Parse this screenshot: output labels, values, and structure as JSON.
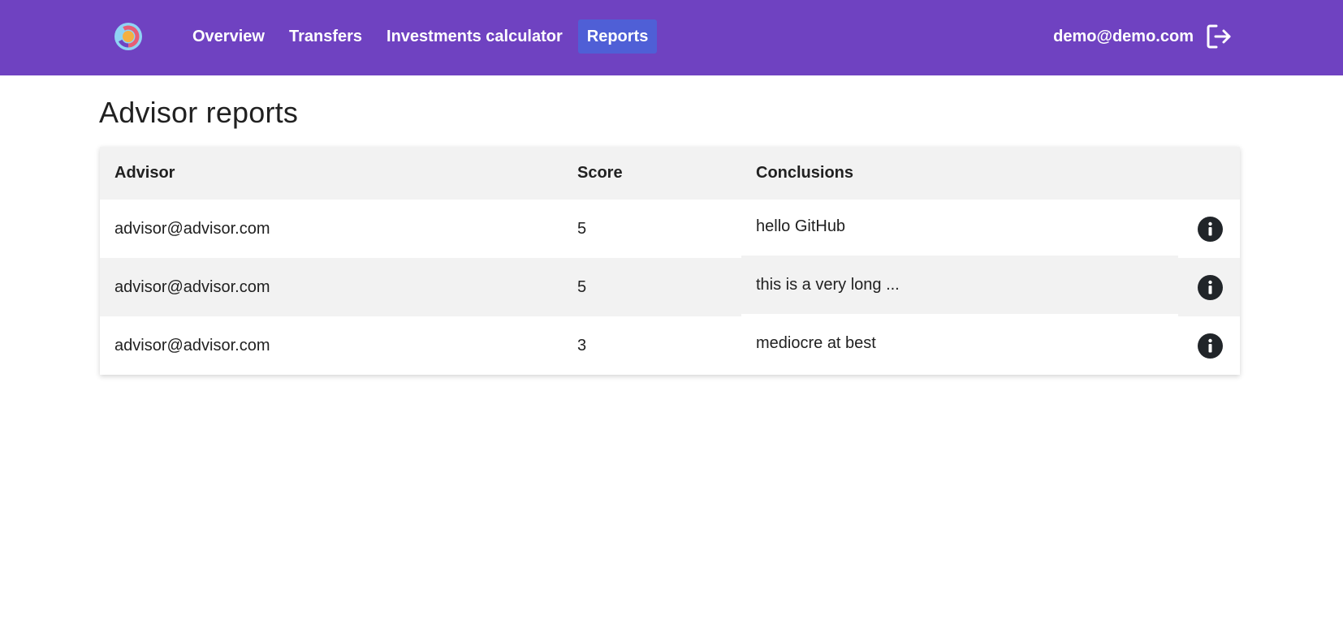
{
  "nav": {
    "links": [
      {
        "label": "Overview",
        "active": false
      },
      {
        "label": "Transfers",
        "active": false
      },
      {
        "label": "Investments calculator",
        "active": false
      },
      {
        "label": "Reports",
        "active": true
      }
    ],
    "user_email": "demo@demo.com",
    "logo_icon": "donut-logo-icon",
    "logout_icon": "logout-icon"
  },
  "page": {
    "title": "Advisor reports"
  },
  "table": {
    "columns": [
      "Advisor",
      "Score",
      "Conclusions"
    ],
    "rows": [
      {
        "advisor": "advisor@advisor.com",
        "score": "5",
        "conclusion": "hello GitHub"
      },
      {
        "advisor": "advisor@advisor.com",
        "score": "5",
        "conclusion": "this is a very long ..."
      },
      {
        "advisor": "advisor@advisor.com",
        "score": "3",
        "conclusion": "mediocre at best"
      }
    ],
    "row_action_icon": "info-icon"
  },
  "colors": {
    "navbar": "#6f42c1",
    "active_link": "#4f5fd6",
    "header_row": "#f2f2f2",
    "text": "#212121"
  }
}
